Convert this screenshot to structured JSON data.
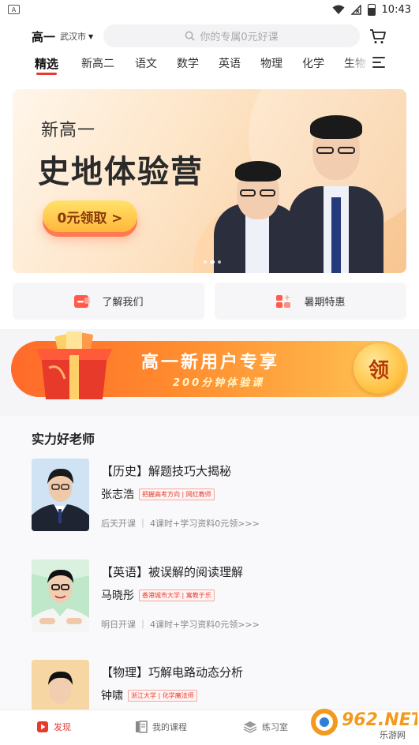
{
  "statusbar": {
    "time": "10:43"
  },
  "header": {
    "grade": "高一",
    "city": "武汉市",
    "search_placeholder": "你的专属0元好课",
    "tabs": [
      {
        "label": "精选",
        "active": true
      },
      {
        "label": "新高二"
      },
      {
        "label": "语文"
      },
      {
        "label": "数学"
      },
      {
        "label": "英语"
      },
      {
        "label": "物理"
      },
      {
        "label": "化学"
      },
      {
        "label": "生物"
      }
    ]
  },
  "banner": {
    "subtitle": "新高一",
    "title": "史地体验营",
    "button": "0元领取 >"
  },
  "quick_links": [
    {
      "label": "了解我们",
      "icon": "id-card-icon"
    },
    {
      "label": "暑期特惠",
      "icon": "gift-icon"
    }
  ],
  "promo": {
    "title": "高一新用户专享",
    "subtitle": "200分钟体验课",
    "button": "领"
  },
  "teachers_section": {
    "title": "实力好老师",
    "teachers": [
      {
        "course": "【历史】解题技巧大揭秘",
        "name": "张志浩",
        "tag": "把握高考方向 | 网红教师",
        "info": "后天开课 ｜ 4课时+学习资料0元领>>>"
      },
      {
        "course": "【英语】被误解的阅读理解",
        "name": "马晓彤",
        "tag": "香港城市大学 | 寓教于乐",
        "info": "明日开课 ｜ 4课时+学习资料0元领>>>"
      },
      {
        "course": "【物理】巧解电路动态分析",
        "name": "钟啸",
        "tag": "浙江大学 | 化学魔法师",
        "info": ""
      }
    ]
  },
  "bottom_nav": [
    {
      "label": "发现",
      "icon": "play-icon",
      "active": true
    },
    {
      "label": "我的课程",
      "icon": "book-icon"
    },
    {
      "label": "练习室",
      "icon": "layers-icon"
    }
  ],
  "watermark": {
    "text": "962.NET",
    "subtext": "乐游网"
  },
  "colors": {
    "accent": "#e8392c",
    "promo_orange": "#ff7a2e"
  }
}
